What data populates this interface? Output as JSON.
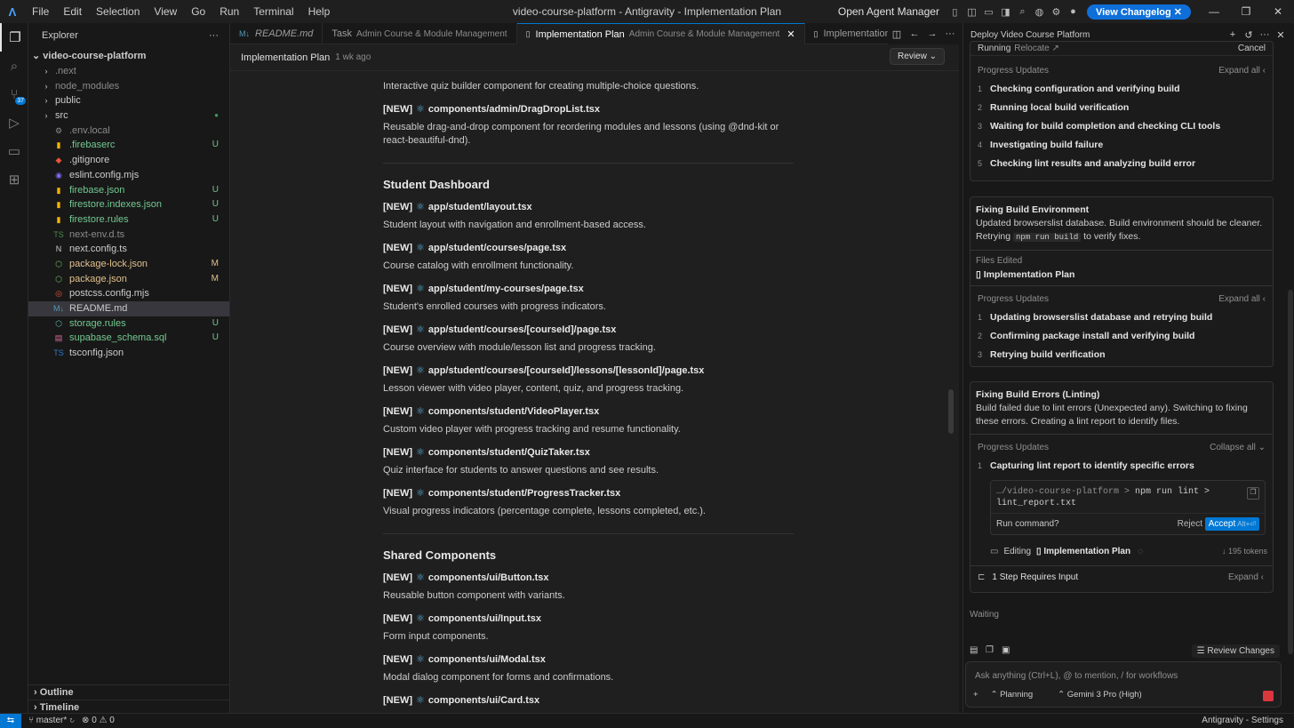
{
  "titlebar": {
    "menu": [
      "File",
      "Edit",
      "Selection",
      "View",
      "Go",
      "Run",
      "Terminal",
      "Help"
    ],
    "title": "video-course-platform - Antigravity - Implementation Plan",
    "agent_manager": "Open Agent Manager",
    "changelog": "View Changelog"
  },
  "activity": {
    "badge": "37"
  },
  "explorer": {
    "title": "Explorer",
    "root": "video-course-platform",
    "items": [
      {
        "label": ".next",
        "color": "#8b8b8b",
        "folder": true
      },
      {
        "label": "node_modules",
        "color": "#8b8b8b",
        "folder": true
      },
      {
        "label": "public",
        "color": "#cccccc",
        "folder": true
      },
      {
        "label": "src",
        "color": "#cccccc",
        "folder": true,
        "dot": "#3f9b5d"
      },
      {
        "label": ".env.local",
        "color": "#8b8b8b",
        "icon": "⚙",
        "iconColor": "#8b8b8b"
      },
      {
        "label": ".firebaserc",
        "color": "#73c991",
        "icon": "▮",
        "iconColor": "#f5b400",
        "status": "U"
      },
      {
        "label": ".gitignore",
        "color": "#cccccc",
        "icon": "◆",
        "iconColor": "#e8553a"
      },
      {
        "label": "eslint.config.mjs",
        "color": "#cccccc",
        "icon": "◉",
        "iconColor": "#7b6cf6"
      },
      {
        "label": "firebase.json",
        "color": "#73c991",
        "icon": "▮",
        "iconColor": "#f5b400",
        "status": "U"
      },
      {
        "label": "firestore.indexes.json",
        "color": "#73c991",
        "icon": "▮",
        "iconColor": "#f5b400",
        "status": "U"
      },
      {
        "label": "firestore.rules",
        "color": "#73c991",
        "icon": "▮",
        "iconColor": "#f5b400",
        "status": "U"
      },
      {
        "label": "next-env.d.ts",
        "color": "#8b8b8b",
        "icon": "TS",
        "iconColor": "#4c8a4c"
      },
      {
        "label": "next.config.ts",
        "color": "#cccccc",
        "icon": "N",
        "iconColor": "#cccccc"
      },
      {
        "label": "package-lock.json",
        "color": "#e2c08d",
        "icon": "⬡",
        "iconColor": "#6cbf5c",
        "status": "M"
      },
      {
        "label": "package.json",
        "color": "#e2c08d",
        "icon": "⬡",
        "iconColor": "#6cbf5c",
        "status": "M"
      },
      {
        "label": "postcss.config.mjs",
        "color": "#cccccc",
        "icon": "◎",
        "iconColor": "#e8553a"
      },
      {
        "label": "README.md",
        "color": "#cccccc",
        "icon": "M↓",
        "iconColor": "#519aba",
        "selected": true
      },
      {
        "label": "storage.rules",
        "color": "#73c991",
        "icon": "⬡",
        "iconColor": "#5cb8a8",
        "status": "U"
      },
      {
        "label": "supabase_schema.sql",
        "color": "#73c991",
        "icon": "▤",
        "iconColor": "#e06c9f",
        "status": "U"
      },
      {
        "label": "tsconfig.json",
        "color": "#cccccc",
        "icon": "TS",
        "iconColor": "#3178c6"
      }
    ],
    "outline": "Outline",
    "timeline": "Timeline"
  },
  "tabs": [
    {
      "icon": "M↓",
      "label": "README.md",
      "desc": "",
      "italic": true
    },
    {
      "icon": "",
      "label": "Task",
      "desc": "Admin Course & Module Management"
    },
    {
      "icon": "▯",
      "label": "Implementation Plan",
      "desc": "Admin Course & Module Management",
      "active": true,
      "close": "✕"
    },
    {
      "icon": "▯",
      "label": "Implementation Plan",
      "desc": ""
    }
  ],
  "plan": {
    "title": "Implementation Plan",
    "time": "1 wk ago",
    "review": "Review"
  },
  "doc": {
    "intro_desc": "Interactive quiz builder component for creating multiple-choice questions.",
    "blocks_a": [
      {
        "tag": "[NEW]",
        "path": "components/admin/DragDropList.tsx",
        "desc": "Reusable drag-and-drop component for reordering modules and lessons (using @dnd-kit or react-beautiful-dnd)."
      }
    ],
    "section_student": "Student Dashboard",
    "blocks_b": [
      {
        "tag": "[NEW]",
        "path": "app/student/layout.tsx",
        "desc": "Student layout with navigation and enrollment-based access."
      },
      {
        "tag": "[NEW]",
        "path": "app/student/courses/page.tsx",
        "desc": "Course catalog with enrollment functionality."
      },
      {
        "tag": "[NEW]",
        "path": "app/student/my-courses/page.tsx",
        "desc": "Student's enrolled courses with progress indicators."
      },
      {
        "tag": "[NEW]",
        "path": "app/student/courses/[courseId]/page.tsx",
        "desc": "Course overview with module/lesson list and progress tracking."
      },
      {
        "tag": "[NEW]",
        "path": "app/student/courses/[courseId]/lessons/[lessonId]/page.tsx",
        "desc": "Lesson viewer with video player, content, quiz, and progress tracking."
      },
      {
        "tag": "[NEW]",
        "path": "components/student/VideoPlayer.tsx",
        "desc": "Custom video player with progress tracking and resume functionality."
      },
      {
        "tag": "[NEW]",
        "path": "components/student/QuizTaker.tsx",
        "desc": "Quiz interface for students to answer questions and see results."
      },
      {
        "tag": "[NEW]",
        "path": "components/student/ProgressTracker.tsx",
        "desc": "Visual progress indicators (percentage complete, lessons completed, etc.)."
      }
    ],
    "section_shared": "Shared Components",
    "blocks_c": [
      {
        "tag": "[NEW]",
        "path": "components/ui/Button.tsx",
        "desc": "Reusable button component with variants."
      },
      {
        "tag": "[NEW]",
        "path": "components/ui/Input.tsx",
        "desc": "Form input components."
      },
      {
        "tag": "[NEW]",
        "path": "components/ui/Modal.tsx",
        "desc": "Modal dialog component for forms and confirmations."
      },
      {
        "tag": "[NEW]",
        "path": "components/ui/Card.tsx",
        "desc": ""
      }
    ]
  },
  "agent": {
    "title": "Deploy Video Course Platform",
    "running": "Running",
    "relocate": "Relocate",
    "cancel": "Cancel",
    "progress_label": "Progress Updates",
    "expand_all": "Expand all",
    "collapse_all": "Collapse all",
    "steps1": [
      "Checking configuration and verifying build",
      "Running local build verification",
      "Waiting for build completion and checking CLI tools",
      "Investigating build failure",
      "Checking lint results and analyzing build error"
    ],
    "card2_title": "Fixing Build Environment",
    "card2_desc_a": "Updated browserslist database. Build environment should be cleaner. Retrying",
    "card2_code": "npm run build",
    "card2_desc_b": "to verify fixes.",
    "files_edited": "Files Edited",
    "file_name": "Implementation Plan",
    "steps2": [
      "Updating browserslist database and retrying build",
      "Confirming package install and verifying build",
      "Retrying build verification"
    ],
    "card3_title": "Fixing Build Errors (Linting)",
    "card3_desc": "Build failed due to lint errors (Unexpected any). Switching to fixing these errors. Creating a lint report to identify files.",
    "steps3": [
      "Capturing lint report to identify specific errors"
    ],
    "cmd_path": "…/video-course-platform >",
    "cmd": "npm run lint > lint_report.txt",
    "run_command": "Run command?",
    "reject": "Reject",
    "accept": "Accept",
    "accept_kbd": "Alt+⏎",
    "editing": "Editing",
    "editing_file": "Implementation Plan",
    "tokens": "195 tokens",
    "requires_input": "1 Step Requires Input",
    "expand": "Expand",
    "waiting": "Waiting",
    "review_changes": "Review Changes",
    "input_placeholder": "Ask anything (Ctrl+L), @ to mention, / for workflows",
    "mode": "Planning",
    "model": "Gemini 3 Pro (High)"
  },
  "status": {
    "branch": "master*",
    "errors": "0",
    "warnings": "0",
    "right": "Antigravity - Settings"
  }
}
